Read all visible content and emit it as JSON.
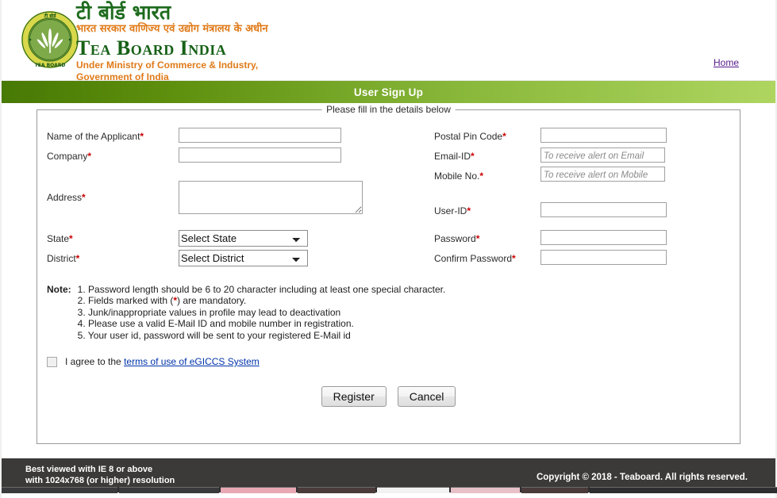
{
  "header": {
    "logo_alt": "Tea Board India seal",
    "hindi_title": "टी बोर्ड भारत",
    "hindi_subtitle": "भारत सरकार वाणिज्य एवं उद्योग मंत्रालय के अधीन",
    "english_title": "Tea Board India",
    "english_subtitle_line1": "Under Ministry of Commerce & Industry,",
    "english_subtitle_line2": "Government of India",
    "home_link": "Home"
  },
  "banner": {
    "title": "User Sign Up",
    "gradient_from": "#477905",
    "gradient_to": "#aed560"
  },
  "form": {
    "legend": "Please fill in the details below",
    "left": {
      "name_label": "Name of the Applicant",
      "name_value": "",
      "company_label": "Company",
      "company_value": "",
      "address_label": "Address",
      "address_value": "",
      "state_label": "State",
      "state_selected": "Select State",
      "district_label": "District",
      "district_selected": "Select District"
    },
    "right": {
      "pin_label": "Postal Pin Code",
      "pin_value": "",
      "email_label": "Email-ID",
      "email_value": "",
      "email_placeholder": "To receive alert on Email",
      "mobile_label": "Mobile No.",
      "mobile_value": "",
      "mobile_placeholder": "To receive alert on Mobile",
      "userid_label": "User-ID",
      "userid_value": "",
      "password_label": "Password",
      "password_value": "",
      "confirm_label": "Confirm Password",
      "confirm_value": ""
    },
    "required_marker": "*"
  },
  "notes": {
    "label": "Note:",
    "items": [
      "1. Password length should be 6 to 20 character including at least one special character.",
      "2. Fields marked with (*) are mandatory.",
      "3. Junk/inappropriate values in profile may lead to deactivation",
      "4. Please use a valid E-Mail ID and mobile number in registration.",
      "5. Your user id, password will be sent to your registered E-Mail id"
    ]
  },
  "agreement": {
    "checked": false,
    "text_before": "I agree to the",
    "link_text": "terms of use of eGICCS System"
  },
  "actions": {
    "register_label": "Register",
    "cancel_label": "Cancel"
  },
  "footer": {
    "line1": "Best viewed with IE 8 or above",
    "line2": "with 1024x768 (or higher) resolution",
    "copyright": "Copyright © 2018 - Teaboard. All rights reserved.",
    "background": "#3b3a38"
  }
}
